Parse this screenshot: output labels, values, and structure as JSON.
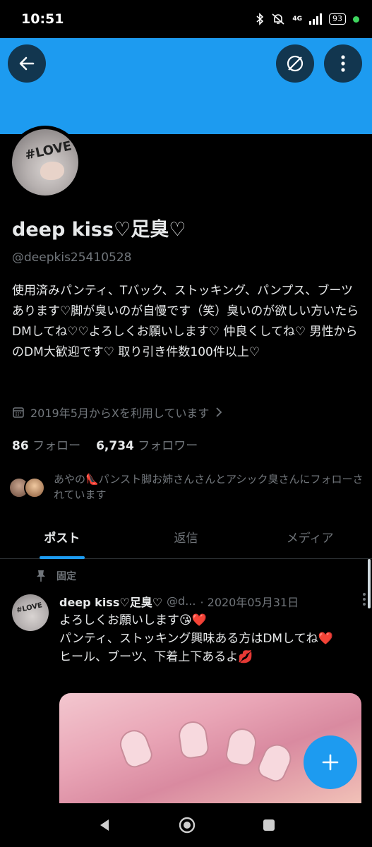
{
  "status_bar": {
    "time": "10:51",
    "network": "4G",
    "battery": "93"
  },
  "profile": {
    "display_name": "deep kiss♡足臭♡",
    "handle": "@deepkis25410528",
    "bio": "使用済みパンティ、Tバック、ストッキング、パンプス、ブーツあります♡脚が臭いのが自慢です（笑）臭いのが欲しい方いたらDMしてね♡♡よろしくお願いします♡ 仲良くしてね♡ 男性からのDM大歓迎です♡ 取り引き件数100件以上♡",
    "joined": "2019年5月からXを利用しています",
    "following_count": "86",
    "following_label": "フォロー",
    "followers_count": "6,734",
    "followers_label": "フォロワー",
    "followed_by": "あやの👠パンスト脚お姉さんさんとアシック臭さんにフォローされています",
    "avatar_text": "#LOVE"
  },
  "tabs": [
    {
      "label": "ポスト",
      "active": true
    },
    {
      "label": "返信",
      "active": false
    },
    {
      "label": "メディア",
      "active": false
    }
  ],
  "pinned_tweet": {
    "pinned_label": "固定",
    "name": "deep kiss♡足臭♡",
    "handle_truncated": "@d...",
    "date": "· 2020年05月31日",
    "line1": "よろしくお願いします😘❤️",
    "line2": "パンティ、ストッキング興味ある方はDMしてね❤️",
    "line3": "ヒール、ブーツ、下着上下あるよ💋",
    "avatar_text": "#LOVE"
  },
  "colors": {
    "banner": "#1d9bf0",
    "accent": "#1d9bf0",
    "secondary_text": "#71767b"
  },
  "icons": [
    "back-arrow-icon",
    "no-sync-icon",
    "more-vertical-icon",
    "calendar-icon",
    "chevron-right-icon",
    "pin-icon",
    "plus-icon"
  ]
}
